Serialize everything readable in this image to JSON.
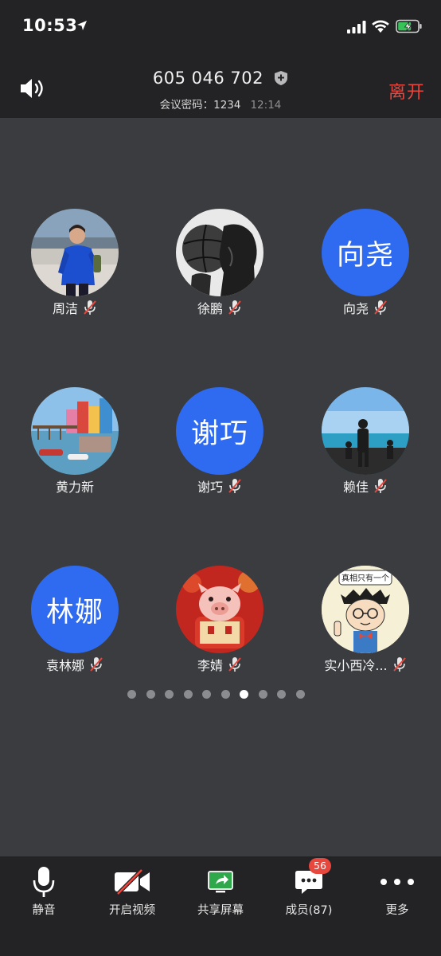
{
  "status_bar": {
    "time": "10:53"
  },
  "header": {
    "meeting_id": "605 046 702",
    "password_label": "会议密码：",
    "password_value": "1234",
    "duration": "12:14",
    "leave_label": "离开"
  },
  "participants": [
    {
      "name": "周洁",
      "avatar_type": "photo",
      "muted": true
    },
    {
      "name": "徐鹏",
      "avatar_type": "photo",
      "muted": true
    },
    {
      "name": "向尧",
      "avatar_type": "initials",
      "initials": "向尧",
      "muted": true
    },
    {
      "name": "黄力新",
      "avatar_type": "photo",
      "muted": false
    },
    {
      "name": "谢巧",
      "avatar_type": "initials",
      "initials": "谢巧",
      "muted": true
    },
    {
      "name": "赖佳",
      "avatar_type": "photo",
      "muted": true
    },
    {
      "name": "袁林娜",
      "avatar_type": "initials",
      "initials": "林娜",
      "muted": true
    },
    {
      "name": "李婧",
      "avatar_type": "photo",
      "muted": true
    },
    {
      "name": "实小西冷...",
      "avatar_type": "photo",
      "avatar_caption": "真相只有一个",
      "muted": true
    }
  ],
  "pagination": {
    "total_pages": 10,
    "current_page": 7
  },
  "toolbar": {
    "mute_label": "静音",
    "video_label": "开启视频",
    "share_label": "共享屏幕",
    "members_label": "成员(87)",
    "members_badge": "56",
    "more_label": "更多"
  },
  "colors": {
    "header_bg": "#232325",
    "grid_bg": "#3a3c3f",
    "avatar_blue": "#2f6bf0",
    "leave_red": "#e6473f",
    "badge_red": "#e8473e",
    "share_green": "#2ea84a"
  },
  "icons": [
    "location-arrow-icon",
    "signal-icon",
    "wifi-icon",
    "battery-charging-icon",
    "speaker-icon",
    "shield-icon",
    "mic-muted-icon",
    "microphone-icon",
    "video-off-icon",
    "share-screen-icon",
    "chat-bubble-icon",
    "more-icon"
  ]
}
